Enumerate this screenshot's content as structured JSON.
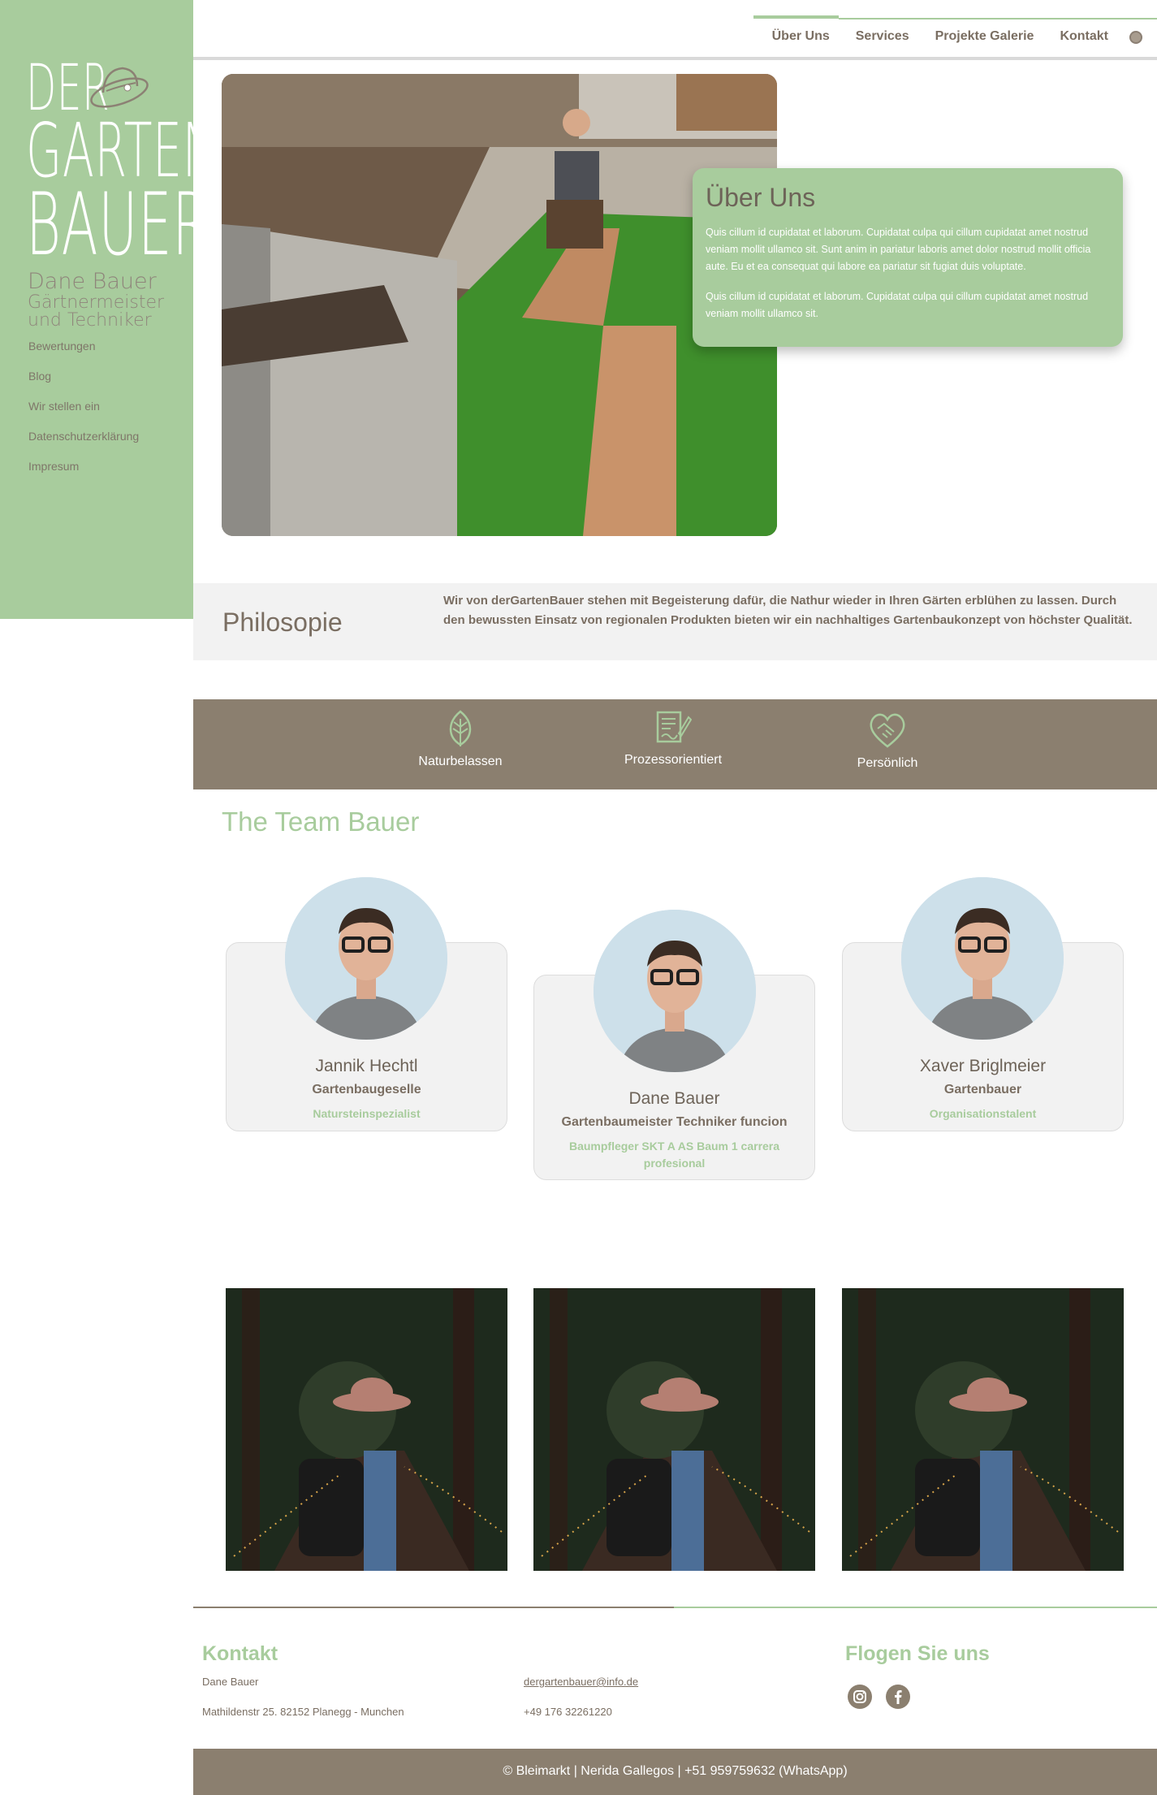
{
  "brand": {
    "logo_lines": [
      "DER",
      "GARTEN",
      "BAUER"
    ],
    "owner": "Dane Bauer",
    "title_line1": "Gärtnermeister",
    "title_line2": "und Techniker"
  },
  "sidebar": {
    "items": [
      {
        "label": "Bewertungen"
      },
      {
        "label": "Blog"
      },
      {
        "label": "Wir stellen ein"
      },
      {
        "label": "Datenschutzerklärung"
      },
      {
        "label": "Impresum"
      }
    ]
  },
  "nav": {
    "items": [
      {
        "label": "Über Uns",
        "active": true
      },
      {
        "label": "Services"
      },
      {
        "label": "Projekte Galerie"
      },
      {
        "label": "Kontakt"
      }
    ]
  },
  "about": {
    "title": "Über Uns",
    "para1": "Quis cillum id cupidatat et laborum. Cupidatat culpa qui cillum cupidatat amet nostrud veniam mollit ullamco sit. Sunt anim in pariatur laboris amet dolor nostrud mollit officia aute. Eu et ea consequat qui labore ea pariatur sit fugiat duis voluptate.",
    "para2": "Quis cillum id cupidatat et laborum. Cupidatat culpa qui cillum cupidatat amet nostrud veniam mollit ullamco sit."
  },
  "philosophy": {
    "title": "Philosopie",
    "text": "Wir von derGartenBauer stehen mit Begeisterung dafür, die Nathur wieder in Ihren Gärten erblühen zu lassen. Durch den bewussten Einsatz von regionalen Produkten bieten wir ein nachhaltiges Gartenbaukonzept von höchster Qualität."
  },
  "values": [
    {
      "label": "Naturbelassen",
      "icon": "leaf-icon"
    },
    {
      "label": "Prozessorientiert",
      "icon": "document-pen-icon"
    },
    {
      "label": "Persönlich",
      "icon": "handshake-heart-icon"
    }
  ],
  "team": {
    "title": "The Team Bauer",
    "members": [
      {
        "name": "Jannik Hechtl",
        "role": "Gartenbaugeselle",
        "skill": "Natursteinspezialist"
      },
      {
        "name": "Dane Bauer",
        "role": "Gartenbaumeister Techniker funcion",
        "skill": "Baumpfleger SKT A AS Baum 1 carrera profesional"
      },
      {
        "name": "Xaver Briglmeier",
        "role": "Gartenbauer",
        "skill": "Organisationstalent"
      }
    ]
  },
  "footer": {
    "contact_title": "Kontakt",
    "name": "Dane Bauer",
    "address": "Mathildenstr 25. 82152 Planegg - Munchen",
    "email": "dergartenbauer@info.de",
    "phone": "+49 176 32261220",
    "social_title": "Flogen Sie uns",
    "social_icons": [
      "instagram-icon",
      "facebook-icon"
    ],
    "copyright": "© Bleimarkt | Nerida Gallegos | +51 959759632 (WhatsApp)"
  },
  "colors": {
    "accent": "#a8cc9d",
    "brown": "#8b7f6f",
    "text": "#7a6e62",
    "panel": "#f2f2f2"
  }
}
